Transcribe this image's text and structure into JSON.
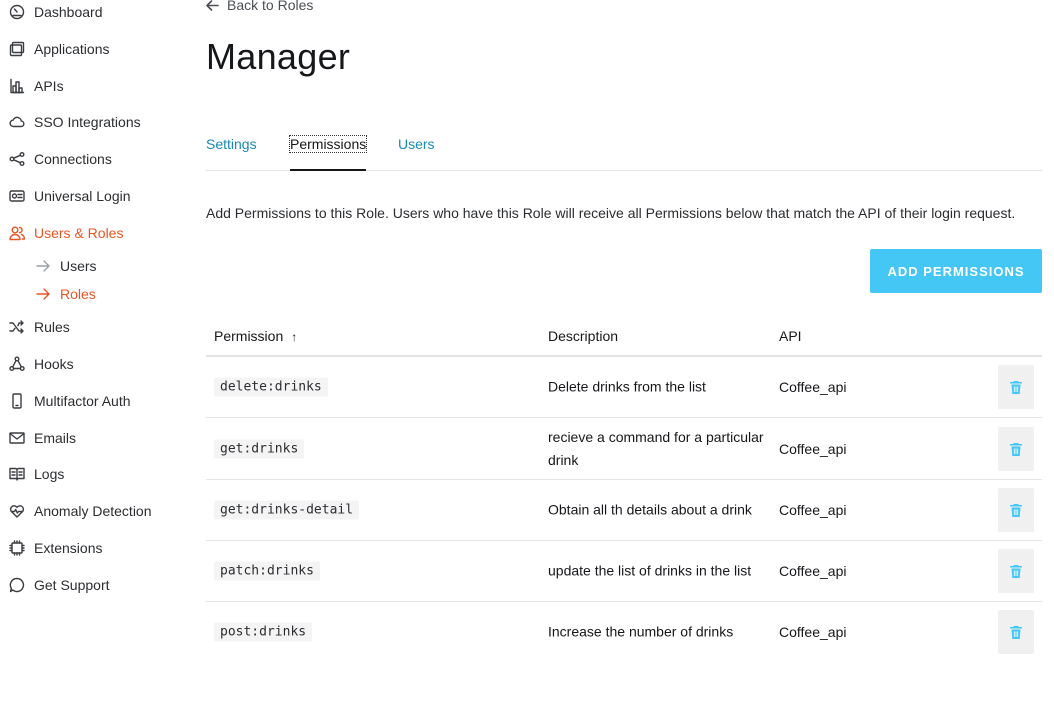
{
  "sidebar": {
    "items": [
      {
        "label": "Dashboard",
        "icon": "dashboard-icon"
      },
      {
        "label": "Applications",
        "icon": "applications-icon"
      },
      {
        "label": "APIs",
        "icon": "apis-icon"
      },
      {
        "label": "SSO Integrations",
        "icon": "cloud-icon"
      },
      {
        "label": "Connections",
        "icon": "connections-icon"
      },
      {
        "label": "Universal Login",
        "icon": "universal-login-icon"
      },
      {
        "label": "Users & Roles",
        "icon": "users-icon"
      },
      {
        "label": "Rules",
        "icon": "rules-icon"
      },
      {
        "label": "Hooks",
        "icon": "hooks-icon"
      },
      {
        "label": "Multifactor Auth",
        "icon": "phone-icon"
      },
      {
        "label": "Emails",
        "icon": "mail-icon"
      },
      {
        "label": "Logs",
        "icon": "logs-icon"
      },
      {
        "label": "Anomaly Detection",
        "icon": "heart-pulse-icon"
      },
      {
        "label": "Extensions",
        "icon": "chip-icon"
      },
      {
        "label": "Get Support",
        "icon": "chat-icon"
      }
    ],
    "sub_items": [
      {
        "label": "Users"
      },
      {
        "label": "Roles"
      }
    ],
    "active_color": "#eb5424"
  },
  "header": {
    "back_label": "Back to Roles",
    "title": "Manager"
  },
  "tabs": [
    {
      "label": "Settings"
    },
    {
      "label": "Permissions"
    },
    {
      "label": "Users"
    }
  ],
  "description": "Add Permissions to this Role. Users who have this Role will receive all Permissions below that match the API of their login request.",
  "add_button_label": "ADD PERMISSIONS",
  "table": {
    "headers": {
      "permission": "Permission",
      "description": "Description",
      "api": "API"
    },
    "rows": [
      {
        "permission": "delete:drinks",
        "description": "Delete drinks from the list",
        "api": "Coffee_api"
      },
      {
        "permission": "get:drinks",
        "description": "recieve a command for a particular drink",
        "api": "Coffee_api"
      },
      {
        "permission": "get:drinks-detail",
        "description": "Obtain all th details about a drink",
        "api": "Coffee_api"
      },
      {
        "permission": "patch:drinks",
        "description": "update the list of drinks in the list",
        "api": "Coffee_api"
      },
      {
        "permission": "post:drinks",
        "description": "Increase the number of drinks",
        "api": "Coffee_api"
      }
    ]
  },
  "colors": {
    "accent": "#eb5424",
    "link": "#1a8ab5",
    "button": "#44c7f4",
    "delete_icon": "#44c7f4"
  }
}
